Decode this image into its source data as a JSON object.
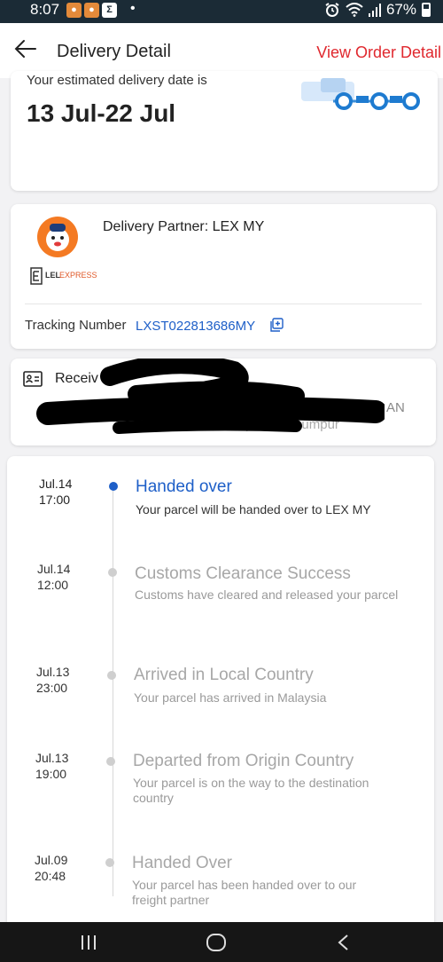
{
  "status_bar": {
    "time": "8:07",
    "dot": "•",
    "battery": "67%",
    "icons": [
      "app-icon",
      "app-icon",
      "sigma-icon",
      "alarm-icon",
      "wifi-icon",
      "signal-icon",
      "battery-icon"
    ]
  },
  "header": {
    "title": "Delivery Detail",
    "order_link": "View Order Detail",
    "back_icon": "back-arrow-icon"
  },
  "estimate": {
    "label": "Your estimated delivery date is",
    "date": "13 Jul-22 Jul"
  },
  "partner": {
    "label": "Delivery Partner: LEX MY",
    "logo_text": "LEL",
    "logo_text_accent": "EXPRESS",
    "tracking_label": "Tracking Number",
    "tracking_number": "LXST022813686MY"
  },
  "receiver": {
    "label": "Receiv",
    "right_fragment_1": "AN",
    "right_fragment_2": "ur, Wp Kuala Lumpur"
  },
  "timeline": [
    {
      "date": "Jul.14",
      "time": "17:00",
      "title": "Handed over",
      "desc": "Your parcel will be handed over to LEX MY",
      "active": true
    },
    {
      "date": "Jul.14",
      "time": "12:00",
      "title": "Customs Clearance Success",
      "desc": "Customs have cleared and released your parcel",
      "active": false
    },
    {
      "date": "Jul.13",
      "time": "23:00",
      "title": "Arrived in Local Country",
      "desc": "Your parcel has arrived in Malaysia",
      "active": false
    },
    {
      "date": "Jul.13",
      "time": "19:00",
      "title": "Departed from Origin Country",
      "desc": "Your parcel is on the way to the destination country",
      "active": false
    },
    {
      "date": "Jul.09",
      "time": "20:48",
      "title": "Handed Over",
      "desc": "Your parcel has been handed over to our freight partner",
      "active": false
    }
  ],
  "colors": {
    "accent_red": "#e0282e",
    "accent_blue": "#1e5fc8",
    "status_bar": "#1b2b36"
  }
}
